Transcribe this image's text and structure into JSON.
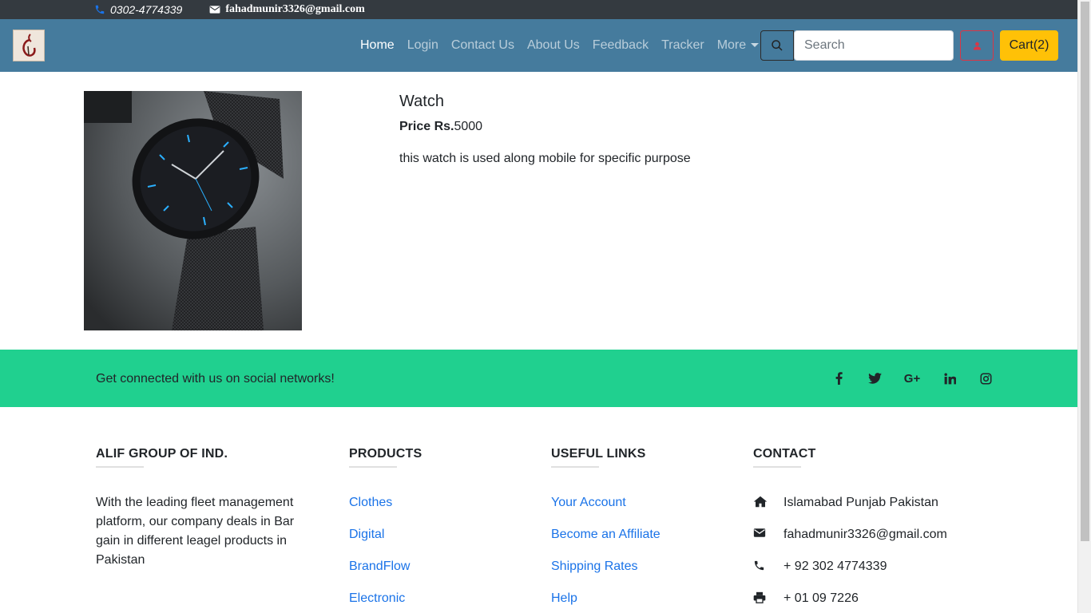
{
  "topbar": {
    "phone": "0302-4774339",
    "email": "fahadmunir3326@gmail.com"
  },
  "nav": {
    "links": [
      "Home",
      "Login",
      "Contact Us",
      "About Us",
      "Feedback",
      "Tracker",
      "More"
    ],
    "search_placeholder": "Search",
    "cart_label": "Cart(2)"
  },
  "product": {
    "title": "Watch",
    "price_label": "Price Rs.",
    "price_value": "5000",
    "description": "this watch is used along mobile for specific purpose"
  },
  "social": {
    "text": "Get connected with us on social networks!",
    "icons": [
      "facebook-icon",
      "twitter-icon",
      "google-plus-icon",
      "linkedin-icon",
      "instagram-icon"
    ]
  },
  "footer": {
    "about": {
      "heading": "ALIF GROUP OF IND.",
      "text": "With the leading fleet management platform, our company deals in Bar gain in different leagel products in Pakistan"
    },
    "products": {
      "heading": "PRODUCTS",
      "items": [
        "Clothes",
        "Digital",
        "BrandFlow",
        "Electronic"
      ]
    },
    "links": {
      "heading": "USEFUL LINKS",
      "items": [
        "Your Account",
        "Become an Affiliate",
        "Shipping Rates",
        "Help"
      ]
    },
    "contact": {
      "heading": "CONTACT",
      "address": "Islamabad Punjab Pakistan",
      "email": "fahadmunir3326@gmail.com",
      "phone": "+ 92 302 4774339",
      "fax": "+ 01 09 7226"
    }
  },
  "colors": {
    "topbar": "#343a40",
    "navbar": "#457b9d",
    "social": "#20d08f",
    "cart": "#ffc107",
    "link": "#1a73e8"
  }
}
